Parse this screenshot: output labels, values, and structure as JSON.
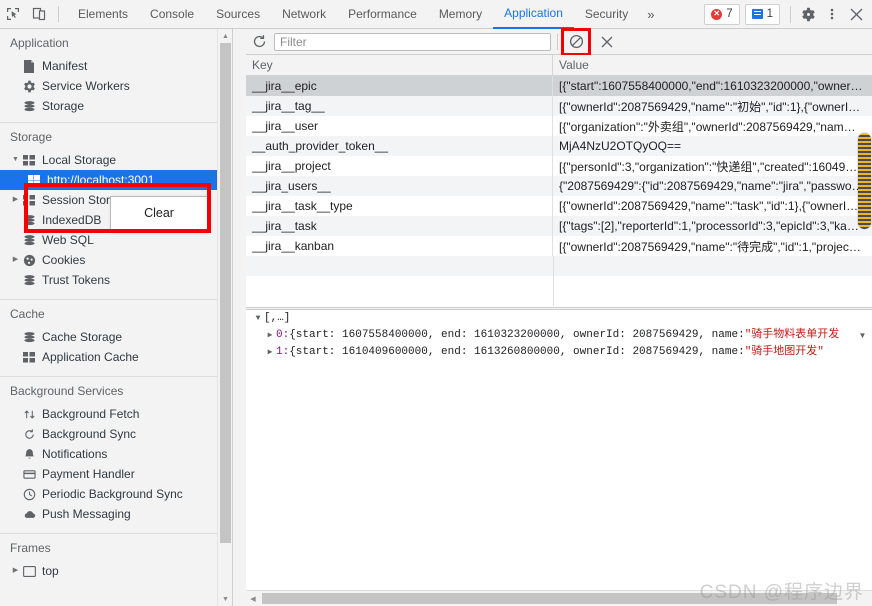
{
  "topbar": {
    "inspect_icon": "inspect-element-icon",
    "device_icon": "device-toolbar-icon",
    "tabs": [
      {
        "label": "Elements",
        "active": false
      },
      {
        "label": "Console",
        "active": false
      },
      {
        "label": "Sources",
        "active": false
      },
      {
        "label": "Network",
        "active": false
      },
      {
        "label": "Performance",
        "active": false
      },
      {
        "label": "Memory",
        "active": false
      },
      {
        "label": "Application",
        "active": true
      },
      {
        "label": "Security",
        "active": false
      }
    ],
    "more_tabs": "»",
    "error_count": "7",
    "message_count": "1",
    "settings_icon": "gear-icon",
    "more_icon": "kebab-menu-icon",
    "close_icon": "close-icon"
  },
  "sidebar": {
    "sections": [
      {
        "title": "Application",
        "items": [
          {
            "label": "Manifest",
            "icon": "manifest-icon",
            "indent": 1,
            "arrow": "none",
            "selected": false
          },
          {
            "label": "Service Workers",
            "icon": "gear-icon",
            "indent": 1,
            "arrow": "none",
            "selected": false
          },
          {
            "label": "Storage",
            "icon": "database-icon",
            "indent": 1,
            "arrow": "none",
            "selected": false
          }
        ]
      },
      {
        "title": "Storage",
        "items": [
          {
            "label": "Local Storage",
            "icon": "table-icon",
            "indent": 1,
            "arrow": "down",
            "selected": false
          },
          {
            "label": "http://localhost:3001",
            "icon": "table-icon",
            "indent": 2,
            "arrow": "none",
            "selected": true
          },
          {
            "label": "Session Storage",
            "icon": "table-icon",
            "indent": 1,
            "arrow": "right",
            "selected": false
          },
          {
            "label": "IndexedDB",
            "icon": "database-icon",
            "indent": 1,
            "arrow": "none",
            "selected": false
          },
          {
            "label": "Web SQL",
            "icon": "database-icon",
            "indent": 1,
            "arrow": "none",
            "selected": false
          },
          {
            "label": "Cookies",
            "icon": "cookie-icon",
            "indent": 1,
            "arrow": "right",
            "selected": false
          },
          {
            "label": "Trust Tokens",
            "icon": "database-icon",
            "indent": 1,
            "arrow": "none",
            "selected": false
          }
        ]
      },
      {
        "title": "Cache",
        "items": [
          {
            "label": "Cache Storage",
            "icon": "database-icon",
            "indent": 1,
            "arrow": "none",
            "selected": false
          },
          {
            "label": "Application Cache",
            "icon": "table-icon",
            "indent": 1,
            "arrow": "none",
            "selected": false
          }
        ]
      },
      {
        "title": "Background Services",
        "items": [
          {
            "label": "Background Fetch",
            "icon": "arrows-updown-icon",
            "indent": 1,
            "arrow": "none",
            "selected": false
          },
          {
            "label": "Background Sync",
            "icon": "sync-icon",
            "indent": 1,
            "arrow": "none",
            "selected": false
          },
          {
            "label": "Notifications",
            "icon": "bell-icon",
            "indent": 1,
            "arrow": "none",
            "selected": false
          },
          {
            "label": "Payment Handler",
            "icon": "card-icon",
            "indent": 1,
            "arrow": "none",
            "selected": false
          },
          {
            "label": "Periodic Background Sync",
            "icon": "clock-icon",
            "indent": 1,
            "arrow": "none",
            "selected": false
          },
          {
            "label": "Push Messaging",
            "icon": "cloud-icon",
            "indent": 1,
            "arrow": "none",
            "selected": false
          }
        ]
      },
      {
        "title": "Frames",
        "items": [
          {
            "label": "top",
            "icon": "frame-icon",
            "indent": 1,
            "arrow": "right",
            "selected": false
          }
        ]
      }
    ]
  },
  "context_menu": {
    "items": [
      "Clear"
    ]
  },
  "filterbar": {
    "refresh_icon": "refresh-icon",
    "placeholder": "Filter",
    "value": "",
    "clear_all_icon": "clear-all-icon",
    "delete_selected_icon": "close-icon"
  },
  "table": {
    "columns": [
      "Key",
      "Value"
    ],
    "rows": [
      {
        "key": "__jira__epic",
        "value": "[{\"start\":1607558400000,\"end\":1610323200000,\"owner…",
        "selected": true
      },
      {
        "key": "__jira__tag__",
        "value": "[{\"ownerId\":2087569429,\"name\":\"初始\",\"id\":1},{\"ownerI…",
        "selected": false
      },
      {
        "key": "__jira__user",
        "value": "[{\"organization\":\"外卖组\",\"ownerId\":2087569429,\"nam…",
        "selected": false
      },
      {
        "key": "__auth_provider_token__",
        "value": "MjA4NzU2OTQyOQ==",
        "selected": false
      },
      {
        "key": "__jira__project",
        "value": "[{\"personId\":3,\"organization\":\"快递组\",\"created\":16049…",
        "selected": false
      },
      {
        "key": "__jira_users__",
        "value": "{\"2087569429\":{\"id\":2087569429,\"name\":\"jira\",\"passwo…",
        "selected": false
      },
      {
        "key": "__jira__task__type",
        "value": "[{\"ownerId\":2087569429,\"name\":\"task\",\"id\":1},{\"ownerI…",
        "selected": false
      },
      {
        "key": "__jira__task",
        "value": "[{\"tags\":[2],\"reporterId\":1,\"processorId\":3,\"epicId\":3,\"ka…",
        "selected": false
      },
      {
        "key": "__jira__kanban",
        "value": "[{\"ownerId\":2087569429,\"name\":\"待完成\",\"id\":1,\"projec…",
        "selected": false
      }
    ]
  },
  "preview": {
    "root": "[,…]",
    "entries": [
      {
        "index": "0:",
        "text": " {start: 1607558400000, end: 1610323200000, ownerId: 2087569429, name: ",
        "string": "\"骑手物料表单开发"
      },
      {
        "index": "1:",
        "text": " {start: 1610409600000, end: 1613260800000, ownerId: 2087569429, name: ",
        "string": "\"骑手地图开发\""
      }
    ]
  },
  "watermark": "CSDN @程序边界",
  "colors": {
    "accent": "#1a73e8",
    "selection": "#1a73e8",
    "annotation": "#f50000",
    "error": "#e53935",
    "panel_bg": "#f3f3f3"
  }
}
